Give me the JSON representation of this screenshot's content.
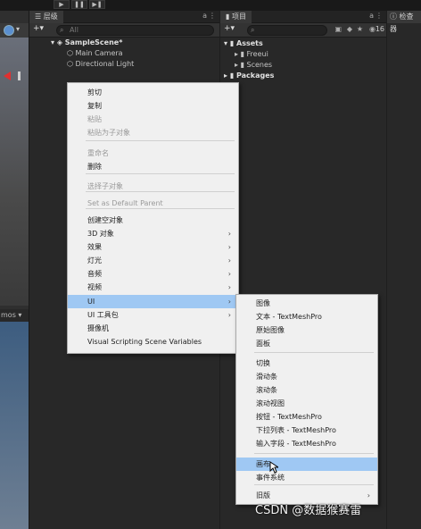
{
  "toolbar": {
    "play": "▶",
    "pause": "❚❚",
    "step": "▶❚"
  },
  "game": {
    "tab_label": "mos ▾"
  },
  "hierarchy": {
    "tab": "层级",
    "search_placeholder": "All",
    "add": "+▾",
    "scene": "SampleScene*",
    "items": [
      "Main Camera",
      "Directional Light"
    ]
  },
  "project": {
    "tab": "项目",
    "add": "+▾",
    "count": "16",
    "tree": [
      "Assets",
      "Freeui",
      "Scenes",
      "Packages"
    ]
  },
  "inspector": {
    "tab": "检查器"
  },
  "context_menu": {
    "items": [
      {
        "label": "剪切",
        "disabled": false,
        "sub": false
      },
      {
        "label": "复制",
        "disabled": false,
        "sub": false
      },
      {
        "label": "粘贴",
        "disabled": true,
        "sub": false
      },
      {
        "label": "粘贴为子对象",
        "disabled": true,
        "sub": false
      },
      {
        "label": "重命名",
        "disabled": true,
        "sub": false
      },
      {
        "label": "删除",
        "disabled": false,
        "sub": false
      },
      {
        "label": "选择子对象",
        "disabled": true,
        "sub": false
      },
      {
        "label": "Set as Default Parent",
        "disabled": true,
        "sub": false
      },
      {
        "label": "创建空对象",
        "disabled": false,
        "sub": false
      },
      {
        "label": "3D 对象",
        "disabled": false,
        "sub": true
      },
      {
        "label": "效果",
        "disabled": false,
        "sub": true
      },
      {
        "label": "灯光",
        "disabled": false,
        "sub": true
      },
      {
        "label": "音频",
        "disabled": false,
        "sub": true
      },
      {
        "label": "视频",
        "disabled": false,
        "sub": true
      },
      {
        "label": "UI",
        "disabled": false,
        "sub": true
      },
      {
        "label": "UI 工具包",
        "disabled": false,
        "sub": true
      },
      {
        "label": "摄像机",
        "disabled": false,
        "sub": false
      },
      {
        "label": "Visual Scripting Scene Variables",
        "disabled": false,
        "sub": false
      }
    ]
  },
  "ui_submenu": {
    "items": [
      {
        "label": "图像",
        "sub": false
      },
      {
        "label": "文本 - TextMeshPro",
        "sub": false
      },
      {
        "label": "原始图像",
        "sub": false
      },
      {
        "label": "面板",
        "sub": false
      },
      {
        "label": "切换",
        "sub": false
      },
      {
        "label": "滑动条",
        "sub": false
      },
      {
        "label": "滚动条",
        "sub": false
      },
      {
        "label": "滚动视图",
        "sub": false
      },
      {
        "label": "按钮 - TextMeshPro",
        "sub": false
      },
      {
        "label": "下拉列表 - TextMeshPro",
        "sub": false
      },
      {
        "label": "输入字段 - TextMeshPro",
        "sub": false
      },
      {
        "label": "画布",
        "sub": false
      },
      {
        "label": "事件系统",
        "sub": false
      },
      {
        "label": "旧版",
        "sub": true
      }
    ]
  },
  "watermark": "CSDN @数据猴赛雷",
  "colors": {
    "highlight": "#9fc8f3",
    "menu_bg": "#f0f0f0",
    "panel_bg": "#282828"
  }
}
